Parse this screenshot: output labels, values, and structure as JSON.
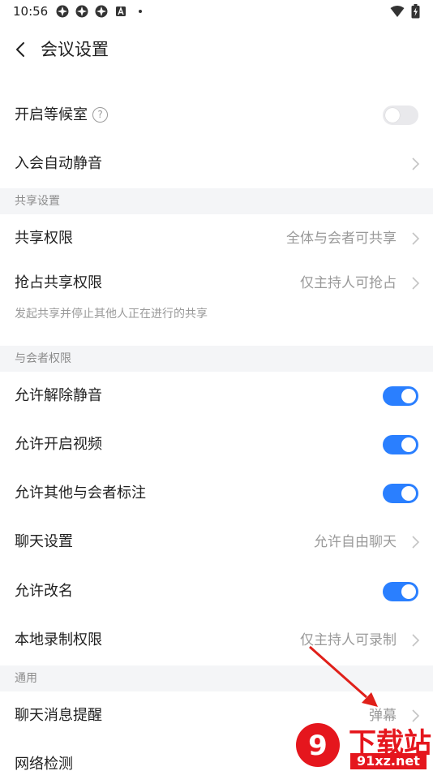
{
  "status_bar": {
    "time": "10:56"
  },
  "header": {
    "title": "会议设置"
  },
  "rows": {
    "waiting_room": {
      "label": "开启等候室",
      "help_symbol": "?",
      "toggle_on": false
    },
    "auto_mute": {
      "label": "入会自动静音"
    },
    "share_permission": {
      "label": "共享权限",
      "value": "全体与会者可共享"
    },
    "grab_share": {
      "label": "抢占共享权限",
      "value": "仅主持人可抢占"
    },
    "unmute": {
      "label": "允许解除静音",
      "toggle_on": true
    },
    "start_video": {
      "label": "允许开启视频",
      "toggle_on": true
    },
    "annotate": {
      "label": "允许其他与会者标注",
      "toggle_on": true
    },
    "chat": {
      "label": "聊天设置",
      "value": "允许自由聊天"
    },
    "rename": {
      "label": "允许改名",
      "toggle_on": true
    },
    "local_record": {
      "label": "本地录制权限",
      "value": "仅主持人可录制"
    },
    "chat_reminder": {
      "label": "聊天消息提醒",
      "value": "弹幕"
    },
    "network_check": {
      "label": "网络检测"
    }
  },
  "sections": {
    "share": "共享设置",
    "participant": "与会者权限",
    "general": "通用"
  },
  "descriptions": {
    "grab_share": "发起共享并停止其他人正在进行的共享"
  },
  "watermark": {
    "big": "下载站",
    "small": "91xz.net",
    "logo": "9"
  },
  "colors": {
    "accent": "#2a7fff",
    "section_bg": "#f4f5f7",
    "arrow": "#e0201a"
  }
}
